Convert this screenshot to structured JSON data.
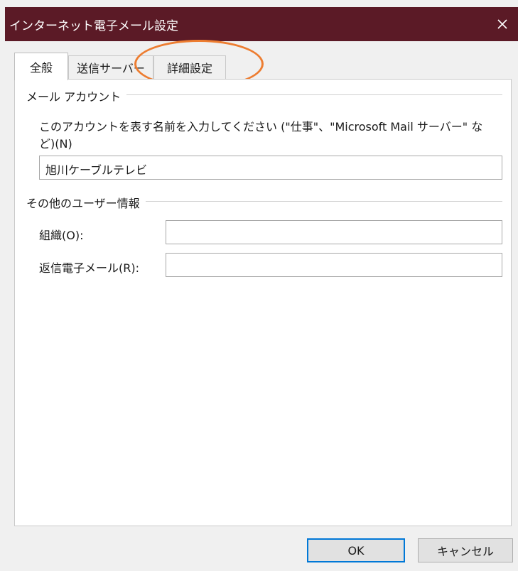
{
  "window": {
    "title": "インターネット電子メール設定",
    "close_icon": "close-icon",
    "colors": {
      "titlebar": "#5b1a26",
      "annotation": "#ed7d31",
      "default_button_border": "#0078d7"
    }
  },
  "tabs": [
    {
      "label": "全般",
      "active": true
    },
    {
      "label": "送信サーバー",
      "active": false
    },
    {
      "label": "詳細設定",
      "active": false
    }
  ],
  "mail_account": {
    "section_title": "メール アカウント",
    "description_line1": "このアカウントを表す名前を入力してください (\"仕事\"、\"Microsoft Mail サーバー\" な",
    "description_line2": "ど)(N)",
    "account_name_value": "旭川ケーブルテレビ"
  },
  "other_user_info": {
    "section_title": "その他のユーザー情報",
    "organization_label": "組織(O):",
    "organization_value": "",
    "reply_email_label": "返信電子メール(R):",
    "reply_email_value": ""
  },
  "buttons": {
    "ok": "OK",
    "cancel": "キャンセル"
  }
}
